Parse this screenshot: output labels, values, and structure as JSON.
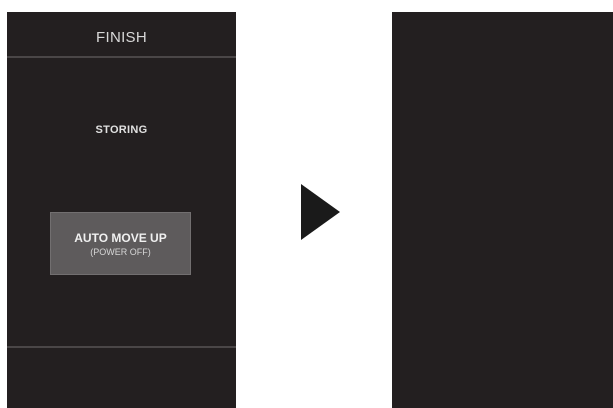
{
  "left_panel": {
    "header_title": "FINISH",
    "status_text": "STORING",
    "auto_move_button": {
      "label": "AUTO MOVE UP",
      "sublabel": "(POWER OFF)"
    }
  },
  "transition_icon": "right-triangle-arrow",
  "colors": {
    "screen_bg": "#231f20",
    "divider": "#4a4647",
    "button_bg": "#5e5b5c",
    "arrow": "#1a1a1a",
    "page_bg": "#ffffff"
  }
}
